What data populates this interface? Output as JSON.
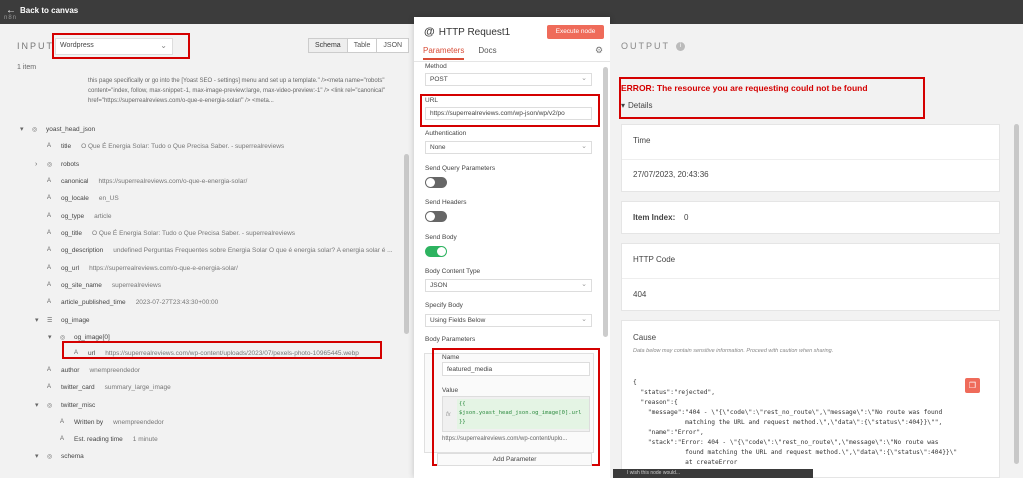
{
  "topbar": {
    "back_label": "Back to canvas",
    "logo_text": "n8n"
  },
  "input": {
    "header": "INPUT",
    "node_selected": "Wordpress",
    "view_tabs": [
      "Schema",
      "Table",
      "JSON"
    ],
    "items_count": "1 item",
    "meta_text": "this page specifically or go into the [Yoast SEO - settings] menu and set up a template.\" /><meta name=\"robots\" content=\"index, follow, max-snippet:-1, max-image-preview:large, max-video-preview:-1\" /> <link rel=\"canonical\" href=\"https://superrealreviews.com/o-que-e-energia-solar/\" /> <meta...",
    "tree": [
      {
        "toggle": "▾",
        "icon": "◎",
        "key": "yoast_head_json",
        "value": ""
      },
      {
        "toggle": "",
        "icon": "A",
        "key": "title",
        "value": "O Que É Energia Solar: Tudo o Que Precisa Saber. - superrealreviews"
      },
      {
        "toggle": "›",
        "icon": "◎",
        "key": "robots",
        "value": ""
      },
      {
        "toggle": "",
        "icon": "A",
        "key": "canonical",
        "value": "https://superrealreviews.com/o-que-e-energia-solar/"
      },
      {
        "toggle": "",
        "icon": "A",
        "key": "og_locale",
        "value": "en_US"
      },
      {
        "toggle": "",
        "icon": "A",
        "key": "og_type",
        "value": "article"
      },
      {
        "toggle": "",
        "icon": "A",
        "key": "og_title",
        "value": "O Que É Energia Solar: Tudo o Que Precisa Saber. - superrealreviews"
      },
      {
        "toggle": "",
        "icon": "A",
        "key": "og_description",
        "value": "undefined Perguntas Frequentes sobre Energia Solar O que é energia solar? A energia solar é ..."
      },
      {
        "toggle": "",
        "icon": "A",
        "key": "og_url",
        "value": "https://superrealreviews.com/o-que-e-energia-solar/"
      },
      {
        "toggle": "",
        "icon": "A",
        "key": "og_site_name",
        "value": "superrealreviews"
      },
      {
        "toggle": "",
        "icon": "A",
        "key": "article_published_time",
        "value": "2023-07-27T23:43:30+00:00"
      },
      {
        "toggle": "▾",
        "icon": "☰",
        "key": "og_image",
        "value": ""
      },
      {
        "toggle": "▾",
        "icon": "◎",
        "key": "og_image[0]",
        "value": ""
      },
      {
        "toggle": "",
        "icon": "A",
        "key": "url",
        "value": "https://superrealreviews.com/wp-content/uploads/2023/07/pexels-photo-10965445.webp"
      },
      {
        "toggle": "",
        "icon": "A",
        "key": "author",
        "value": "wnempreendedor"
      },
      {
        "toggle": "",
        "icon": "A",
        "key": "twitter_card",
        "value": "summary_large_image"
      },
      {
        "toggle": "▾",
        "icon": "◎",
        "key": "twitter_misc",
        "value": ""
      },
      {
        "toggle": "",
        "icon": "A",
        "key": "Written by",
        "value": "wnempreendedor"
      },
      {
        "toggle": "",
        "icon": "A",
        "key": "Est. reading time",
        "value": "1 minute"
      },
      {
        "toggle": "▾",
        "icon": "◎",
        "key": "schema",
        "value": ""
      }
    ]
  },
  "node": {
    "title": "HTTP Request1",
    "execute_label": "Execute node",
    "tabs": [
      "Parameters",
      "Docs"
    ],
    "method_label": "Method",
    "method_value": "POST",
    "url_label": "URL",
    "url_value": "https://superrealreviews.com/wp-json/wp/v2/po",
    "auth_label": "Authentication",
    "auth_value": "None",
    "send_query_label": "Send Query Parameters",
    "send_headers_label": "Send Headers",
    "send_body_label": "Send Body",
    "body_content_type_label": "Body Content Type",
    "body_content_type_value": "JSON",
    "specify_body_label": "Specify Body",
    "specify_body_value": "Using Fields Below",
    "body_params_label": "Body Parameters",
    "param_name_label": "Name",
    "param_name_value": "featured_media",
    "param_value_label": "Value",
    "param_expr_line1": "{{",
    "param_expr_line2": "$json.yoast_head_json.og_image[0].url",
    "param_expr_line3": "}}",
    "param_preview": "https://superrealreviews.com/wp-content/uplo...",
    "add_param_label": "Add Parameter",
    "fx_label": "fx"
  },
  "output": {
    "header": "OUTPUT",
    "error_title": "ERROR: The resource you are requesting could not be found",
    "details_label": "Details",
    "time_label": "Time",
    "time_value": "27/07/2023, 20:43:36",
    "item_index_label": "Item Index:",
    "item_index_value": "0",
    "http_code_label": "HTTP Code",
    "http_code_value": "404",
    "cause_label": "Cause",
    "cause_note": "Data below may contain sensitive information. Proceed with caution when sharing.",
    "json_lines": [
      "{",
      "  \"status\":\"rejected\",",
      "  \"reason\":{",
      "    \"message\":\"404 - \\\"{\\\"code\\\":\\\"rest_no_route\\\",\\\"message\\\":\\\"No route was found",
      "              matching the URL and request method.\\\",\\\"data\\\":{\\\"status\\\":404}}\\\"\",",
      "    \"name\":\"Error\",",
      "    \"stack\":\"Error: 404 - \\\"{\\\"code\\\":\\\"rest_no_route\\\",\\\"message\\\":\\\"No route was",
      "              found matching the URL and request method.\\\",\\\"data\\\":{\\\"status\\\":404}}\\\"",
      "              at createError"
    ]
  },
  "bottom_bar": "I wish this node would..."
}
